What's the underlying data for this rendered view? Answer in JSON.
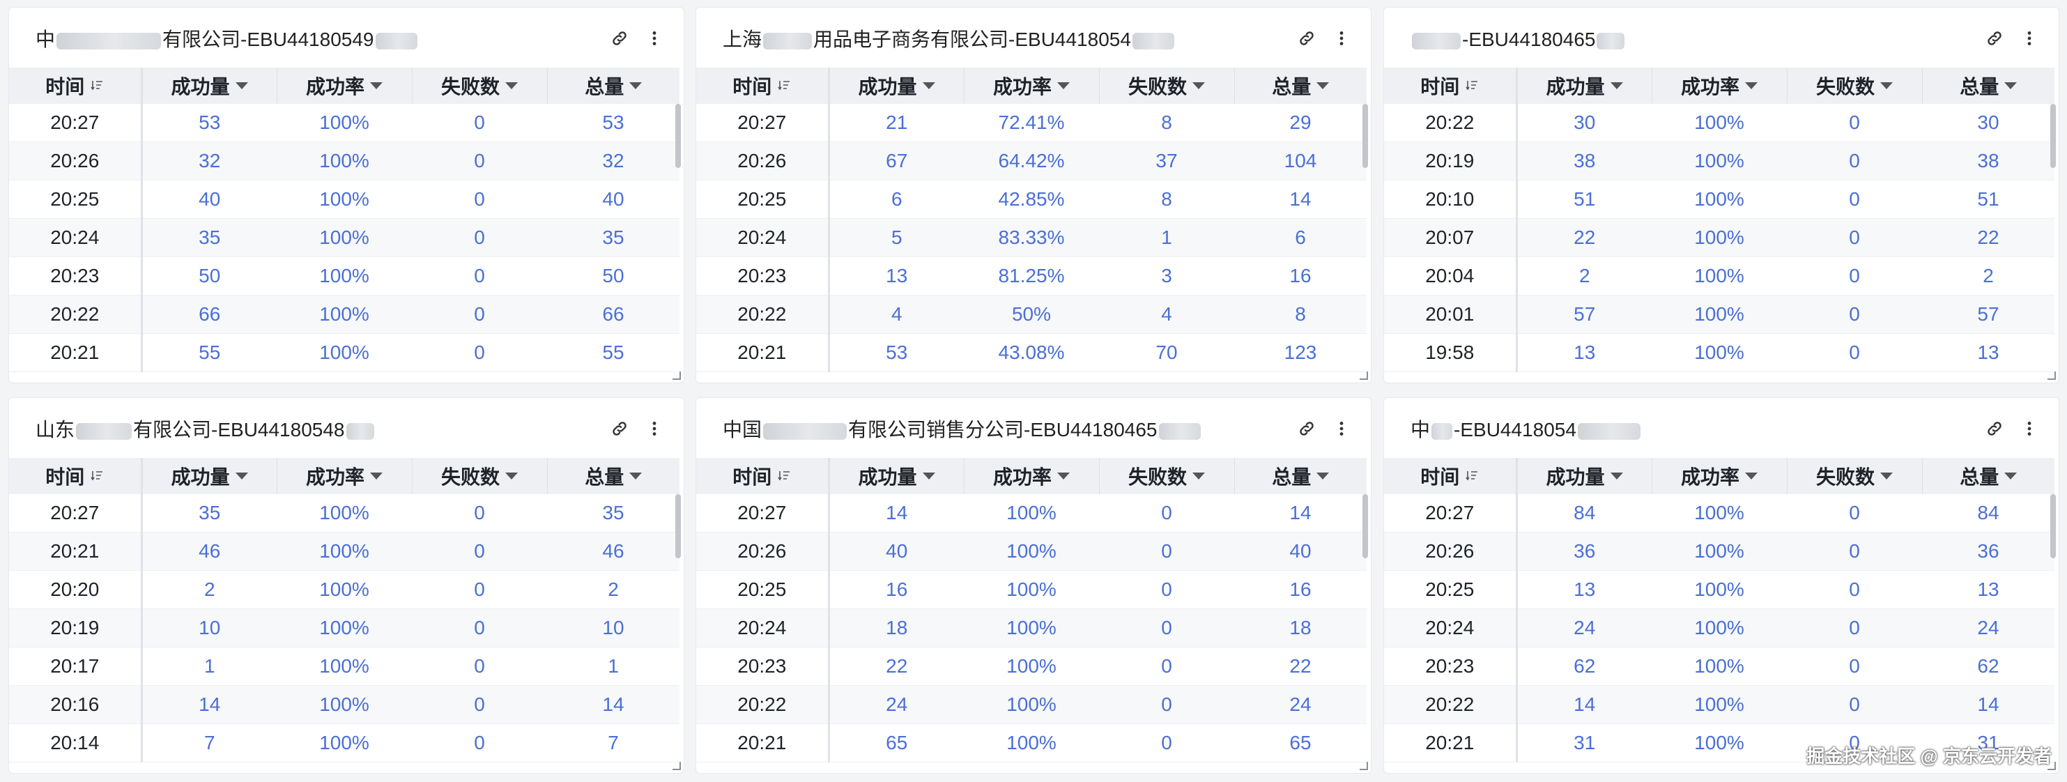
{
  "panels": [
    {
      "title_pre": "中",
      "title_post": "有限公司-EBU44180549",
      "columns": [
        "时间",
        "成功量",
        "成功率",
        "失败数",
        "总量"
      ],
      "rows": [
        [
          "20:27",
          "53",
          "100%",
          "0",
          "53"
        ],
        [
          "20:26",
          "32",
          "100%",
          "0",
          "32"
        ],
        [
          "20:25",
          "40",
          "100%",
          "0",
          "40"
        ],
        [
          "20:24",
          "35",
          "100%",
          "0",
          "35"
        ],
        [
          "20:23",
          "50",
          "100%",
          "0",
          "50"
        ],
        [
          "20:22",
          "66",
          "100%",
          "0",
          "66"
        ],
        [
          "20:21",
          "55",
          "100%",
          "0",
          "55"
        ]
      ]
    },
    {
      "title_pre": "上海",
      "title_post": "用品电子商务有限公司-EBU4418054",
      "columns": [
        "时间",
        "成功量",
        "成功率",
        "失败数",
        "总量"
      ],
      "rows": [
        [
          "20:27",
          "21",
          "72.41%",
          "8",
          "29"
        ],
        [
          "20:26",
          "67",
          "64.42%",
          "37",
          "104"
        ],
        [
          "20:25",
          "6",
          "42.85%",
          "8",
          "14"
        ],
        [
          "20:24",
          "5",
          "83.33%",
          "1",
          "6"
        ],
        [
          "20:23",
          "13",
          "81.25%",
          "3",
          "16"
        ],
        [
          "20:22",
          "4",
          "50%",
          "4",
          "8"
        ],
        [
          "20:21",
          "53",
          "43.08%",
          "70",
          "123"
        ]
      ]
    },
    {
      "title_pre": "",
      "title_post": "-EBU44180465",
      "columns": [
        "时间",
        "成功量",
        "成功率",
        "失败数",
        "总量"
      ],
      "rows": [
        [
          "20:22",
          "30",
          "100%",
          "0",
          "30"
        ],
        [
          "20:19",
          "38",
          "100%",
          "0",
          "38"
        ],
        [
          "20:10",
          "51",
          "100%",
          "0",
          "51"
        ],
        [
          "20:07",
          "22",
          "100%",
          "0",
          "22"
        ],
        [
          "20:04",
          "2",
          "100%",
          "0",
          "2"
        ],
        [
          "20:01",
          "57",
          "100%",
          "0",
          "57"
        ],
        [
          "19:58",
          "13",
          "100%",
          "0",
          "13"
        ]
      ]
    },
    {
      "title_pre": "山东",
      "title_post": "有限公司-EBU44180548",
      "columns": [
        "时间",
        "成功量",
        "成功率",
        "失败数",
        "总量"
      ],
      "rows": [
        [
          "20:27",
          "35",
          "100%",
          "0",
          "35"
        ],
        [
          "20:21",
          "46",
          "100%",
          "0",
          "46"
        ],
        [
          "20:20",
          "2",
          "100%",
          "0",
          "2"
        ],
        [
          "20:19",
          "10",
          "100%",
          "0",
          "10"
        ],
        [
          "20:17",
          "1",
          "100%",
          "0",
          "1"
        ],
        [
          "20:16",
          "14",
          "100%",
          "0",
          "14"
        ],
        [
          "20:14",
          "7",
          "100%",
          "0",
          "7"
        ]
      ]
    },
    {
      "title_pre": "中国",
      "title_post": "有限公司销售分公司-EBU44180465",
      "columns": [
        "时间",
        "成功量",
        "成功率",
        "失败数",
        "总量"
      ],
      "rows": [
        [
          "20:27",
          "14",
          "100%",
          "0",
          "14"
        ],
        [
          "20:26",
          "40",
          "100%",
          "0",
          "40"
        ],
        [
          "20:25",
          "16",
          "100%",
          "0",
          "16"
        ],
        [
          "20:24",
          "18",
          "100%",
          "0",
          "18"
        ],
        [
          "20:23",
          "22",
          "100%",
          "0",
          "22"
        ],
        [
          "20:22",
          "24",
          "100%",
          "0",
          "24"
        ],
        [
          "20:21",
          "65",
          "100%",
          "0",
          "65"
        ]
      ]
    },
    {
      "title_pre": "中",
      "title_post": "-EBU4418054",
      "columns": [
        "时间",
        "成功量",
        "成功率",
        "失败数",
        "总量"
      ],
      "rows": [
        [
          "20:27",
          "84",
          "100%",
          "0",
          "84"
        ],
        [
          "20:26",
          "36",
          "100%",
          "0",
          "36"
        ],
        [
          "20:25",
          "13",
          "100%",
          "0",
          "13"
        ],
        [
          "20:24",
          "24",
          "100%",
          "0",
          "24"
        ],
        [
          "20:23",
          "62",
          "100%",
          "0",
          "62"
        ],
        [
          "20:22",
          "14",
          "100%",
          "0",
          "14"
        ],
        [
          "20:21",
          "31",
          "100%",
          "0",
          "31"
        ]
      ]
    }
  ],
  "footer": {
    "watermark": "掘金技术社区 @ 京东云开发者"
  }
}
